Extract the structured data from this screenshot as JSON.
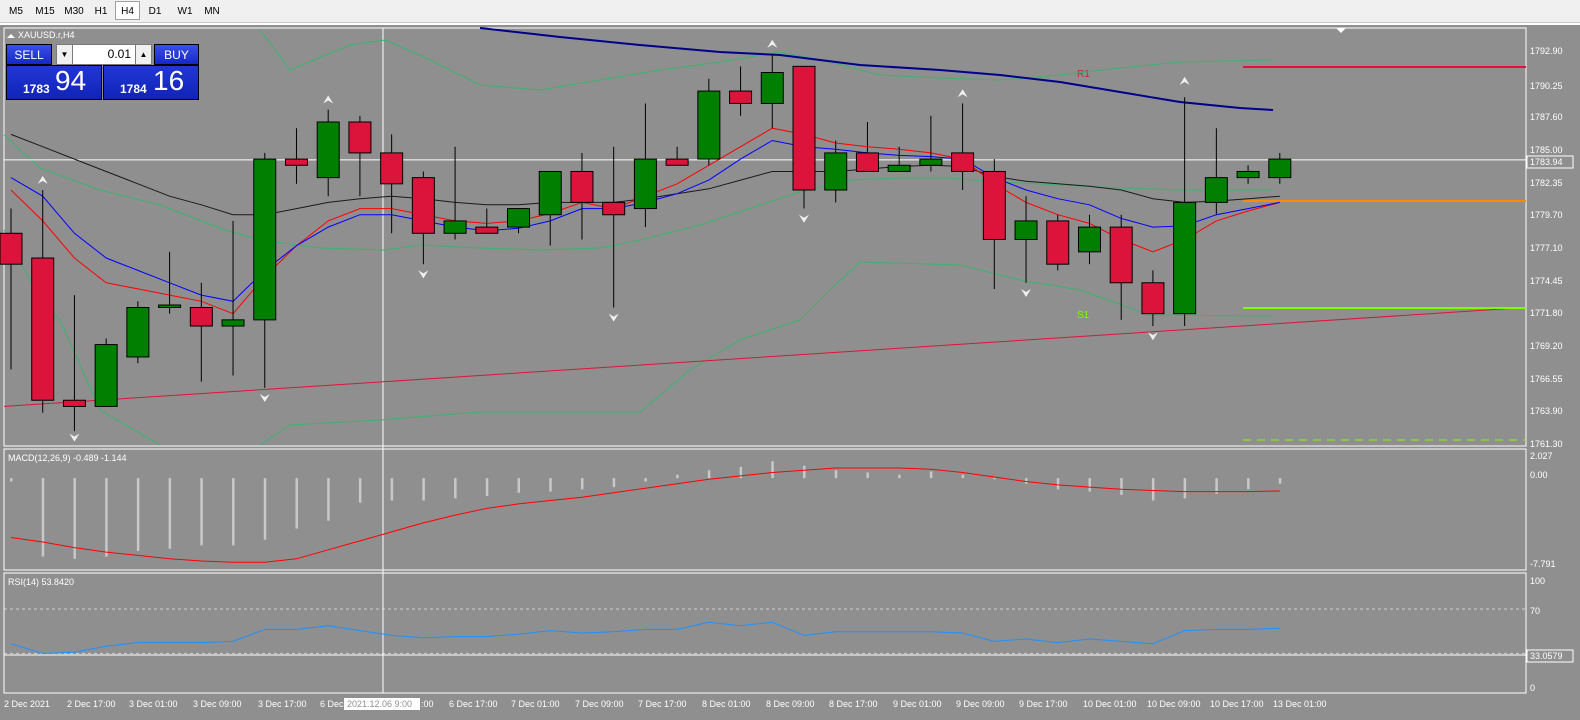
{
  "timeframes": [
    "M5",
    "M15",
    "M30",
    "H1",
    "H4",
    "D1",
    "W1",
    "MN"
  ],
  "active_timeframe": "H4",
  "symbol_label": "XAUUSD.r,H4",
  "trade": {
    "sell_label": "SELL",
    "buy_label": "BUY",
    "lot": "0.01",
    "sell_small": "1783",
    "sell_big": "94",
    "buy_small": "1784",
    "buy_big": "16",
    "lot_down_icon": "triangle-down",
    "lot_up_icon": "triangle-up"
  },
  "main_axis": {
    "ticks": [
      "1792.90",
      "1790.25",
      "1787.60",
      "1785.00",
      "1782.35",
      "1779.70",
      "1777.10",
      "1774.45",
      "1771.80",
      "1769.20",
      "1766.55",
      "1763.90",
      "1761.30"
    ],
    "current_price": "1783.94"
  },
  "pivots": {
    "r1": "R1",
    "s1": "S1"
  },
  "macd": {
    "label": "MACD(12,26,9) -0.489 -1.144",
    "ticks": [
      "2.027",
      "0.00",
      "-7.791"
    ]
  },
  "rsi": {
    "label": "RSI(14) 53.8420",
    "ticks": [
      "100",
      "70",
      "33.0579",
      "0"
    ]
  },
  "time_axis": {
    "labels": [
      "2 Dec 2021",
      "2 Dec 17:00",
      "3 Dec 01:00",
      "3 Dec 09:00",
      "3 Dec 17:00",
      "6 Dec",
      "6 Dec 17:00",
      "7 Dec 01:00",
      "7 Dec 09:00",
      "7 Dec 17:00",
      "8 Dec 01:00",
      "8 Dec 09:00",
      "8 Dec 17:00",
      "9 Dec 01:00",
      "9 Dec 09:00",
      "9 Dec 17:00",
      "10 Dec 01:00",
      "10 Dec 09:00",
      "10 Dec 17:00",
      "13 Dec 01:00"
    ],
    "cursor_label": "2021.12.06 9:00",
    "cursor_suffix": ":00"
  },
  "chart_data": {
    "type": "candlestick",
    "symbol": "XAUUSD.r",
    "timeframe": "H4",
    "ylim": [
      1760.8,
      1794.6
    ],
    "candles": [
      {
        "o": 1778.0,
        "h": 1780.0,
        "l": 1767.0,
        "c": 1775.5
      },
      {
        "o": 1776.0,
        "h": 1781.5,
        "l": 1763.5,
        "c": 1764.5
      },
      {
        "o": 1764.5,
        "h": 1773.0,
        "l": 1762.0,
        "c": 1764.0
      },
      {
        "o": 1764.0,
        "h": 1769.5,
        "l": 1764.0,
        "c": 1769.0
      },
      {
        "o": 1768.0,
        "h": 1772.5,
        "l": 1767.5,
        "c": 1772.0
      },
      {
        "o": 1772.0,
        "h": 1776.5,
        "l": 1771.5,
        "c": 1772.2
      },
      {
        "o": 1772.0,
        "h": 1774.0,
        "l": 1766.0,
        "c": 1770.5
      },
      {
        "o": 1770.5,
        "h": 1779.0,
        "l": 1766.5,
        "c": 1771.0
      },
      {
        "o": 1771.0,
        "h": 1784.5,
        "l": 1765.5,
        "c": 1784.0
      },
      {
        "o": 1784.0,
        "h": 1786.5,
        "l": 1782.0,
        "c": 1783.5
      },
      {
        "o": 1782.5,
        "h": 1788.0,
        "l": 1781.0,
        "c": 1787.0
      },
      {
        "o": 1787.0,
        "h": 1787.5,
        "l": 1781.0,
        "c": 1784.5
      },
      {
        "o": 1784.5,
        "h": 1786.0,
        "l": 1778.0,
        "c": 1782.0
      },
      {
        "o": 1782.5,
        "h": 1783.0,
        "l": 1775.5,
        "c": 1778.0
      },
      {
        "o": 1778.0,
        "h": 1785.0,
        "l": 1777.5,
        "c": 1779.0
      },
      {
        "o": 1778.5,
        "h": 1780.0,
        "l": 1778.0,
        "c": 1778.0
      },
      {
        "o": 1778.5,
        "h": 1780.0,
        "l": 1778.0,
        "c": 1780.0
      },
      {
        "o": 1779.5,
        "h": 1781.5,
        "l": 1777.0,
        "c": 1783.0
      },
      {
        "o": 1783.0,
        "h": 1784.5,
        "l": 1777.5,
        "c": 1780.5
      },
      {
        "o": 1780.5,
        "h": 1785.0,
        "l": 1772.0,
        "c": 1779.5
      },
      {
        "o": 1780.0,
        "h": 1788.5,
        "l": 1778.5,
        "c": 1784.0
      },
      {
        "o": 1784.0,
        "h": 1785.0,
        "l": 1783.5,
        "c": 1783.5
      },
      {
        "o": 1784.0,
        "h": 1790.5,
        "l": 1783.5,
        "c": 1789.5
      },
      {
        "o": 1789.5,
        "h": 1791.5,
        "l": 1787.5,
        "c": 1788.5
      },
      {
        "o": 1788.5,
        "h": 1792.5,
        "l": 1786.5,
        "c": 1791.0
      },
      {
        "o": 1791.5,
        "h": 1791.5,
        "l": 1780.0,
        "c": 1781.5
      },
      {
        "o": 1781.5,
        "h": 1785.5,
        "l": 1780.5,
        "c": 1784.5
      },
      {
        "o": 1784.5,
        "h": 1787.0,
        "l": 1783.0,
        "c": 1783.0
      },
      {
        "o": 1783.0,
        "h": 1785.0,
        "l": 1783.0,
        "c": 1783.5
      },
      {
        "o": 1783.5,
        "h": 1787.5,
        "l": 1783.0,
        "c": 1784.0
      },
      {
        "o": 1784.5,
        "h": 1788.5,
        "l": 1781.5,
        "c": 1783.0
      },
      {
        "o": 1783.0,
        "h": 1784.0,
        "l": 1773.5,
        "c": 1777.5
      },
      {
        "o": 1777.5,
        "h": 1781.0,
        "l": 1774.0,
        "c": 1779.0
      },
      {
        "o": 1779.0,
        "h": 1779.5,
        "l": 1775.0,
        "c": 1775.5
      },
      {
        "o": 1776.5,
        "h": 1779.5,
        "l": 1775.5,
        "c": 1778.5
      },
      {
        "o": 1778.5,
        "h": 1779.5,
        "l": 1771.0,
        "c": 1774.0
      },
      {
        "o": 1774.0,
        "h": 1775.0,
        "l": 1770.5,
        "c": 1771.5
      },
      {
        "o": 1771.5,
        "h": 1789.0,
        "l": 1770.5,
        "c": 1780.5
      },
      {
        "o": 1780.5,
        "h": 1786.5,
        "l": 1779.5,
        "c": 1782.5
      },
      {
        "o": 1782.5,
        "h": 1783.5,
        "l": 1782.0,
        "c": 1783.0
      },
      {
        "o": 1782.5,
        "h": 1784.5,
        "l": 1782.0,
        "c": 1784.0
      }
    ],
    "ma_black": [
      1786.0,
      1785.0,
      1784.0,
      1783.0,
      1782.0,
      1781.0,
      1780.3,
      1779.5,
      1779.5,
      1780.0,
      1780.5,
      1780.8,
      1781.0,
      1780.8,
      1780.5,
      1780.3,
      1780.3,
      1780.5,
      1780.5,
      1780.5,
      1780.8,
      1781.2,
      1781.6,
      1782.3,
      1783.0,
      1783.0,
      1783.0,
      1783.2,
      1783.4,
      1783.5,
      1783.4,
      1782.6,
      1782.2,
      1782.0,
      1781.8,
      1781.5,
      1780.8,
      1780.5,
      1780.6,
      1780.8,
      1781.0
    ],
    "ma_blue": [
      1782.5,
      1781.0,
      1778.0,
      1776.0,
      1775.0,
      1774.0,
      1773.0,
      1772.5,
      1775.0,
      1777.0,
      1778.5,
      1779.5,
      1779.5,
      1779.0,
      1778.5,
      1778.2,
      1778.4,
      1779.0,
      1780.0,
      1780.0,
      1780.5,
      1781.2,
      1782.3,
      1784.0,
      1785.5,
      1785.0,
      1784.8,
      1784.5,
      1784.3,
      1784.2,
      1784.0,
      1782.5,
      1781.5,
      1780.8,
      1780.3,
      1779.2,
      1778.5,
      1778.6,
      1779.5,
      1780.0,
      1780.5
    ],
    "ma_red": [
      1781.5,
      1779.0,
      1776.0,
      1774.0,
      1773.5,
      1773.0,
      1772.5,
      1771.5,
      1774.5,
      1777.0,
      1779.0,
      1780.0,
      1780.0,
      1779.5,
      1779.0,
      1778.8,
      1779.0,
      1779.6,
      1780.5,
      1780.0,
      1781.0,
      1782.0,
      1783.5,
      1785.0,
      1786.5,
      1786.0,
      1785.3,
      1785.0,
      1784.8,
      1784.5,
      1784.0,
      1782.0,
      1780.5,
      1779.5,
      1778.8,
      1777.5,
      1776.5,
      1777.5,
      1779.0,
      1779.8,
      1780.5
    ],
    "trendline": {
      "from": [
        0,
        1764.0
      ],
      "to": [
        47,
        1772.0
      ]
    },
    "current_price": 1783.94,
    "macd_hist": [
      -0.3,
      -7.0,
      -7.2,
      -7.0,
      -6.5,
      -6.3,
      -6.0,
      -6.0,
      -5.5,
      -4.5,
      -3.8,
      -2.2,
      -2.0,
      -2.0,
      -1.8,
      -1.6,
      -1.3,
      -1.2,
      -1.0,
      -0.8,
      -0.3,
      0.3,
      0.7,
      1.0,
      1.5,
      1.1,
      0.7,
      0.5,
      0.3,
      0.6,
      0.3,
      -0.1,
      -0.5,
      -1.0,
      -1.2,
      -1.5,
      -2.0,
      -1.8,
      -1.4,
      -1.0,
      -0.5
    ],
    "macd_signal": [
      -5.3,
      -5.7,
      -6.2,
      -6.6,
      -6.9,
      -7.2,
      -7.4,
      -7.5,
      -7.5,
      -7.2,
      -6.4,
      -5.6,
      -4.8,
      -4.0,
      -3.3,
      -2.7,
      -2.3,
      -2.0,
      -1.7,
      -1.3,
      -0.9,
      -0.5,
      -0.1,
      0.2,
      0.5,
      0.7,
      0.9,
      0.9,
      0.9,
      0.8,
      0.5,
      0.1,
      -0.3,
      -0.6,
      -0.8,
      -1.0,
      -1.1,
      -1.2,
      -1.2,
      -1.2,
      -1.15
    ],
    "rsi_values": [
      41.0,
      33.0,
      34.0,
      39.0,
      42.0,
      42.0,
      42.0,
      43.0,
      53.0,
      53.0,
      56.0,
      52.0,
      48.0,
      46.0,
      47.0,
      47.0,
      49.0,
      52.0,
      50.0,
      51.0,
      53.0,
      53.0,
      59.0,
      56.0,
      59.0,
      48.0,
      51.0,
      51.0,
      51.0,
      51.0,
      50.0,
      43.0,
      45.0,
      42.0,
      45.0,
      43.0,
      41.0,
      52.0,
      53.0,
      53.0,
      54.0
    ],
    "rsi_levels": [
      70,
      33.0579
    ],
    "colors": {
      "background": "#8f8f8f",
      "bull": "#007f00",
      "bear": "#dc143c",
      "ma_black": "#1a1a1a",
      "ma_blue": "#0000ff",
      "ma_red": "#ff0000",
      "ma_slow": "#00008b",
      "envelope": "#3cb371",
      "trendline": "#dc143c",
      "r1_line": "#dc143c",
      "pivot_line": "#ff8c00",
      "s1_line": "#7cfc00",
      "macd_hist": "#c8c8c8",
      "macd_signal": "#ff0000",
      "rsi_line": "#1e90ff"
    }
  }
}
